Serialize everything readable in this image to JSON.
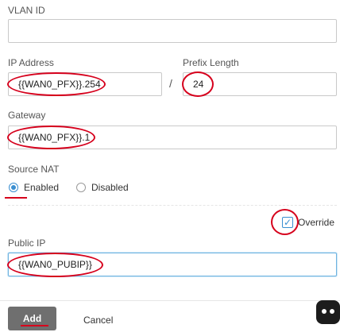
{
  "form": {
    "vlan_id": {
      "label": "VLAN ID",
      "value": ""
    },
    "ip_address": {
      "label": "IP Address",
      "value": "{{WAN0_PFX}}.254"
    },
    "separator": "/",
    "prefix_length": {
      "label": "Prefix Length",
      "value": "24"
    },
    "gateway": {
      "label": "Gateway",
      "value": "{{WAN0_PFX}}.1"
    },
    "source_nat": {
      "label": "Source NAT",
      "options": [
        {
          "label": "Enabled",
          "selected": true
        },
        {
          "label": "Disabled",
          "selected": false
        }
      ]
    },
    "override": {
      "label": "Override",
      "checked": true,
      "check_glyph": "✓"
    },
    "public_ip": {
      "label": "Public IP",
      "value": "{{WAN0_PUBIP}}"
    }
  },
  "actions": {
    "add_label": "Add",
    "cancel_label": "Cancel"
  },
  "colors": {
    "annotation_red": "#d6001c",
    "accent_blue": "#3a8fd1",
    "add_button_bg": "#6f6f6f"
  }
}
